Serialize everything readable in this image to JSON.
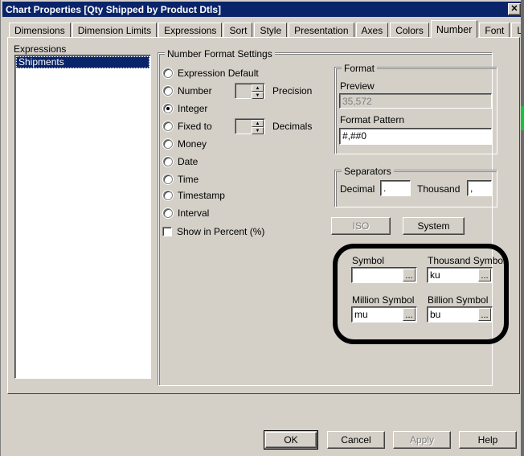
{
  "window": {
    "title": "Chart Properties [Qty Shipped by Product Dtls]",
    "close_label": "✕"
  },
  "tabs": {
    "items": [
      {
        "label": "Dimensions",
        "active": false
      },
      {
        "label": "Dimension Limits",
        "active": false
      },
      {
        "label": "Expressions",
        "active": false
      },
      {
        "label": "Sort",
        "active": false
      },
      {
        "label": "Style",
        "active": false
      },
      {
        "label": "Presentation",
        "active": false
      },
      {
        "label": "Axes",
        "active": false
      },
      {
        "label": "Colors",
        "active": false
      },
      {
        "label": "Number",
        "active": true
      },
      {
        "label": "Font",
        "active": false
      },
      {
        "label": "Layout",
        "active": false
      }
    ],
    "scroll_left": "◄",
    "scroll_right": "►"
  },
  "expressions": {
    "label": "Expressions",
    "items": [
      {
        "label": "Shipments",
        "selected": true
      }
    ]
  },
  "number_format": {
    "group_title": "Number Format Settings",
    "options": [
      {
        "label": "Expression Default",
        "checked": false
      },
      {
        "label": "Number",
        "checked": false
      },
      {
        "label": "Integer",
        "checked": true
      },
      {
        "label": "Fixed to",
        "checked": false
      },
      {
        "label": "Money",
        "checked": false
      },
      {
        "label": "Date",
        "checked": false
      },
      {
        "label": "Time",
        "checked": false
      },
      {
        "label": "Timestamp",
        "checked": false
      },
      {
        "label": "Interval",
        "checked": false
      }
    ],
    "precision_label": "Precision",
    "precision_value": "",
    "decimals_label": "Decimals",
    "decimals_value": "",
    "show_in_percent_label": "Show in Percent (%)",
    "show_in_percent_checked": false,
    "spin_up": "▲",
    "spin_down": "▼"
  },
  "format": {
    "group_title": "Format",
    "preview_label": "Preview",
    "preview_value": "35,572",
    "pattern_label": "Format Pattern",
    "pattern_value": "#,##0"
  },
  "separators": {
    "group_title": "Separators",
    "decimal_label": "Decimal",
    "decimal_value": ".",
    "thousand_label": "Thousand",
    "thousand_value": ","
  },
  "locale_buttons": {
    "iso_label": "ISO",
    "iso_enabled": false,
    "system_label": "System",
    "system_enabled": true
  },
  "symbols": {
    "symbol_label": "Symbol",
    "symbol_value": "",
    "thousand_symbol_label": "Thousand Symbol",
    "thousand_symbol_value": "ku",
    "million_symbol_label": "Million Symbol",
    "million_symbol_value": "mu",
    "billion_symbol_label": "Billion Symbol",
    "billion_symbol_value": "bu",
    "browse_label": "..."
  },
  "footer": {
    "ok_label": "OK",
    "cancel_label": "Cancel",
    "apply_label": "Apply",
    "apply_enabled": false,
    "help_label": "Help"
  },
  "colors": {
    "dialog_face": "#d4d0c8",
    "title_bar": "#0a246a",
    "selection": "#0a246a",
    "highlight_annotation": "#000000",
    "disabled_text": "#808080"
  }
}
